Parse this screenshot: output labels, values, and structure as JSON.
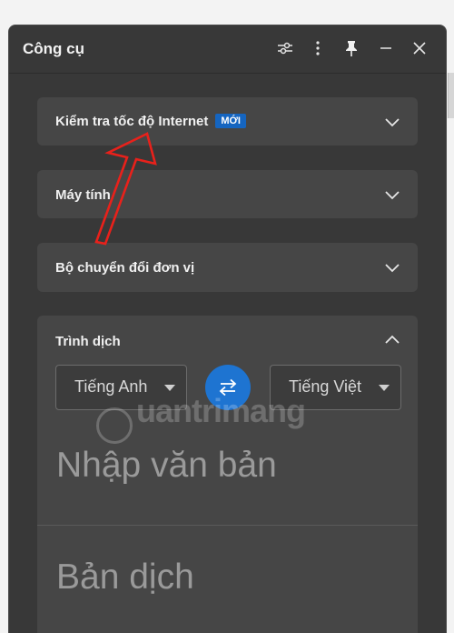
{
  "window": {
    "title": "Công cụ",
    "controls": {
      "settings_icon": "sliders-icon",
      "more_icon": "more-vertical-icon",
      "pin_icon": "pin-icon",
      "minimize_icon": "minimize-icon",
      "close_icon": "close-icon"
    }
  },
  "sections": [
    {
      "label": "Kiểm tra tốc độ Internet",
      "badge": "MỚI",
      "expanded": false
    },
    {
      "label": "Máy tính",
      "expanded": false
    },
    {
      "label": "Bộ chuyển đổi đơn vị",
      "expanded": false
    },
    {
      "label": "Trình dịch",
      "expanded": true
    }
  ],
  "translator": {
    "source_language": "Tiếng Anh",
    "target_language": "Tiếng Việt",
    "swap_icon": "swap-arrows-icon",
    "input_placeholder": "Nhập văn bản",
    "output_placeholder": "Bản dịch"
  },
  "watermark": {
    "text": "uantrimang"
  },
  "annotation": {
    "type": "red-outline-arrow",
    "color": "#e8211b"
  },
  "colors": {
    "accent": "#1e74d1",
    "badge": "#1565c0",
    "panel_bg": "#383838",
    "card_bg": "#464646"
  }
}
